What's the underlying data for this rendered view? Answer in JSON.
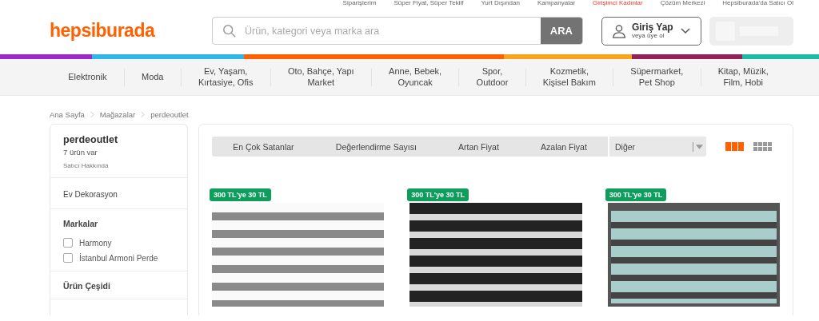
{
  "top_links": [
    {
      "label": "Siparişlerim",
      "highlighted": false
    },
    {
      "label": "Süper Fiyat, Süper Teklif",
      "highlighted": false
    },
    {
      "label": "Yurt Dışından",
      "highlighted": false
    },
    {
      "label": "Kampanyalar",
      "highlighted": false
    },
    {
      "label": "Girişimci Kadınlar",
      "highlighted": true
    },
    {
      "label": "Çözüm Merkezi",
      "highlighted": false
    },
    {
      "label": "Hepsiburada'da Satıcı Ol",
      "highlighted": false
    }
  ],
  "logo": "hepsiburada",
  "search": {
    "placeholder": "Ürün, kategori veya marka ara",
    "button": "ARA"
  },
  "login": {
    "title": "Giriş Yap",
    "subtitle": "veya üye ol"
  },
  "categories": [
    "Elektronik",
    "Moda",
    "Ev, Yaşam,\nKırtasiye, Ofis",
    "Oto, Bahçe, Yapı\nMarket",
    "Anne, Bebek,\nOyuncak",
    "Spor,\nOutdoor",
    "Kozmetik,\nKişisel Bakım",
    "Süpermarket,\nPet Shop",
    "Kitap, Müzik,\nFilm, Hobi"
  ],
  "breadcrumb": [
    "Ana Sayfa",
    "Mağazalar",
    "perdeoutlet"
  ],
  "store": {
    "name": "perdeoutlet",
    "count": "7 ürün var",
    "about": "Satıcı Hakkında"
  },
  "category_filter": "Ev Dekorasyon",
  "brands": {
    "title": "Markalar",
    "items": [
      {
        "label": "Harmony",
        "checked": false
      },
      {
        "label": "İstanbul Armoni Perde",
        "checked": false
      }
    ]
  },
  "product_type": {
    "title": "Ürün Çeşidi"
  },
  "sort_options": [
    "En Çok Satanlar",
    "Değerlendirme Sayısı",
    "Artan Fiyat",
    "Azalan Fiyat"
  ],
  "sort_dropdown": "Diğer",
  "view_modes": [
    {
      "kind": "large",
      "selected": true
    },
    {
      "kind": "small",
      "selected": false
    }
  ],
  "products": [
    {
      "badge": "300 TL'ye 30 TL",
      "kind": "white"
    },
    {
      "badge": "300 TL'ye 30 TL",
      "kind": "black"
    },
    {
      "badge": "300 TL'ye 30 TL",
      "kind": "window"
    }
  ]
}
